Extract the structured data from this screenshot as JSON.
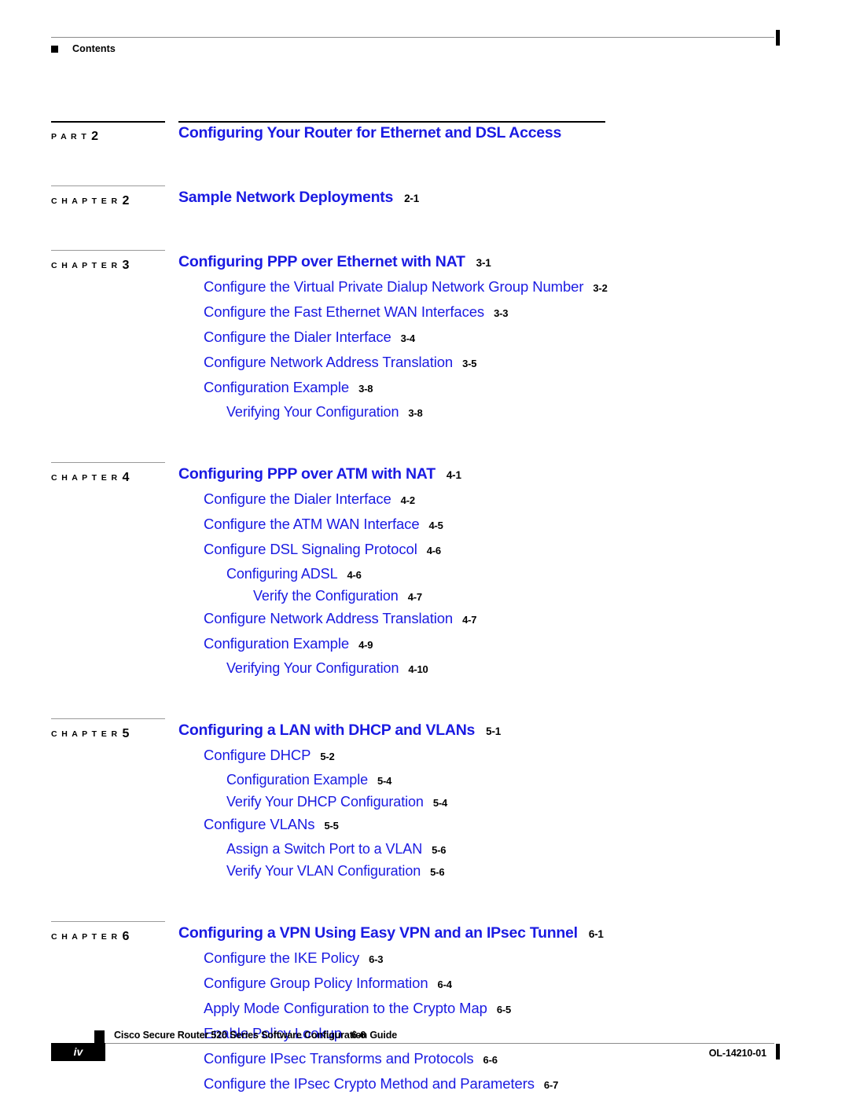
{
  "header": {
    "label": "Contents"
  },
  "footer": {
    "folio": "iv",
    "title": "Cisco Secure Router 520 Series Software Configuration Guide",
    "doc_id": "OL-14210-01"
  },
  "labels": {
    "part_word": "P A R T",
    "chapter_word": "C H A P T E R"
  },
  "toc": [
    {
      "kind": "part",
      "marker_word": "P A R T",
      "marker_num": "2",
      "title": "Configuring Your Router for Ethernet and DSL Access",
      "page": "",
      "entries": []
    },
    {
      "kind": "chapter",
      "marker_word": "C H A P T E R",
      "marker_num": "2",
      "title": "Sample Network Deployments",
      "page": "2-1",
      "entries": []
    },
    {
      "kind": "chapter",
      "marker_word": "C H A P T E R",
      "marker_num": "3",
      "title": "Configuring PPP over Ethernet with NAT",
      "page": "3-1",
      "entries": [
        {
          "level": 2,
          "text": "Configure the Virtual Private Dialup Network Group Number",
          "page": "3-2"
        },
        {
          "level": 2,
          "text": "Configure the Fast Ethernet WAN Interfaces",
          "page": "3-3"
        },
        {
          "level": 2,
          "text": "Configure the Dialer Interface",
          "page": "3-4"
        },
        {
          "level": 2,
          "text": "Configure Network Address Translation",
          "page": "3-5"
        },
        {
          "level": 2,
          "text": "Configuration Example",
          "page": "3-8"
        },
        {
          "level": 3,
          "text": "Verifying Your Configuration",
          "page": "3-8"
        }
      ]
    },
    {
      "kind": "chapter",
      "marker_word": "C H A P T E R",
      "marker_num": "4",
      "title": "Configuring PPP over ATM with NAT",
      "page": "4-1",
      "entries": [
        {
          "level": 2,
          "text": "Configure the Dialer Interface",
          "page": "4-2"
        },
        {
          "level": 2,
          "text": "Configure the ATM WAN Interface",
          "page": "4-5"
        },
        {
          "level": 2,
          "text": "Configure DSL Signaling Protocol",
          "page": "4-6"
        },
        {
          "level": 3,
          "text": "Configuring ADSL",
          "page": "4-6"
        },
        {
          "level": 4,
          "text": "Verify the Configuration",
          "page": "4-7"
        },
        {
          "level": 2,
          "text": "Configure Network Address Translation",
          "page": "4-7"
        },
        {
          "level": 2,
          "text": "Configuration Example",
          "page": "4-9"
        },
        {
          "level": 3,
          "text": "Verifying Your Configuration",
          "page": "4-10"
        }
      ]
    },
    {
      "kind": "chapter",
      "marker_word": "C H A P T E R",
      "marker_num": "5",
      "title": "Configuring a LAN with DHCP and VLANs",
      "page": "5-1",
      "entries": [
        {
          "level": 2,
          "text": "Configure DHCP",
          "page": "5-2"
        },
        {
          "level": 3,
          "text": "Configuration Example",
          "page": "5-4"
        },
        {
          "level": 3,
          "text": "Verify Your DHCP Configuration",
          "page": "5-4"
        },
        {
          "level": 2,
          "text": "Configure VLANs",
          "page": "5-5"
        },
        {
          "level": 3,
          "text": "Assign a Switch Port to a VLAN",
          "page": "5-6"
        },
        {
          "level": 3,
          "text": "Verify Your VLAN Configuration",
          "page": "5-6"
        }
      ]
    },
    {
      "kind": "chapter",
      "marker_word": "C H A P T E R",
      "marker_num": "6",
      "title": "Configuring a VPN Using Easy VPN and an IPsec Tunnel",
      "page": "6-1",
      "entries": [
        {
          "level": 2,
          "text": "Configure the IKE Policy",
          "page": "6-3"
        },
        {
          "level": 2,
          "text": "Configure Group Policy Information",
          "page": "6-4"
        },
        {
          "level": 2,
          "text": "Apply Mode Configuration to the Crypto Map",
          "page": "6-5"
        },
        {
          "level": 2,
          "text": "Enable Policy Lookup",
          "page": "6-6"
        },
        {
          "level": 2,
          "text": "Configure IPsec Transforms and Protocols",
          "page": "6-6"
        },
        {
          "level": 2,
          "text": "Configure the IPsec Crypto Method and Parameters",
          "page": "6-7"
        }
      ]
    }
  ],
  "colors": {
    "link_blue": "#1a1ae2",
    "rule_gray": "#8b8b8b",
    "ink_black": "#000000"
  }
}
